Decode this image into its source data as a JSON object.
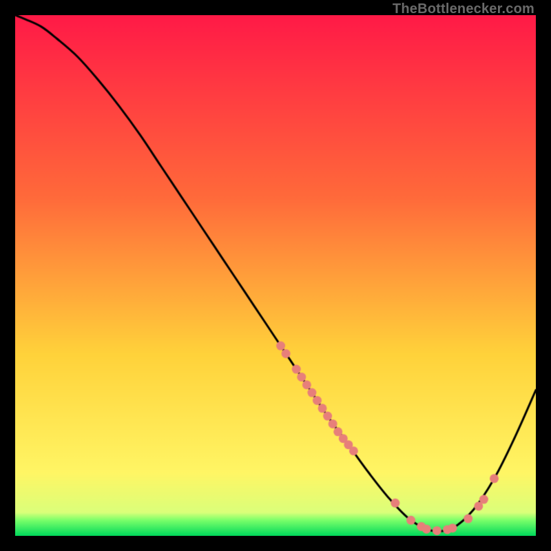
{
  "attribution": "TheBottlenecker.com",
  "colors": {
    "gradient_top": "#ff1a47",
    "gradient_mid1": "#ff6a3a",
    "gradient_mid2": "#ffd23a",
    "gradient_mid3": "#fff665",
    "gradient_bottom": "#00d95b",
    "curve": "#000000",
    "marker": "#e77f7a",
    "frame_bg": "#000000"
  },
  "chart_data": {
    "type": "line",
    "title": "",
    "xlabel": "",
    "ylabel": "",
    "xlim": [
      0,
      100
    ],
    "ylim": [
      0,
      100
    ],
    "grid": false,
    "legend": false,
    "series": [
      {
        "name": "bottleneck-curve",
        "x": [
          0,
          2,
          5,
          8,
          12,
          16,
          20,
          24,
          28,
          32,
          36,
          40,
          44,
          48,
          52,
          56,
          60,
          64,
          68,
          72,
          76,
          80,
          84,
          88,
          92,
          96,
          100
        ],
        "y": [
          100,
          99.2,
          97.8,
          95.5,
          92.0,
          87.5,
          82.5,
          77.0,
          71.0,
          65.0,
          59.0,
          53.0,
          47.0,
          41.0,
          35.0,
          29.0,
          23.0,
          17.5,
          12.0,
          7.0,
          3.0,
          1.0,
          1.5,
          5.0,
          11.0,
          19.0,
          28.0
        ]
      }
    ],
    "markers": {
      "name": "highlighted-points",
      "x": [
        51,
        52,
        54,
        55,
        56,
        57,
        58,
        59,
        60,
        61,
        62,
        63,
        64,
        65,
        73,
        76,
        78,
        79,
        81,
        83,
        84,
        87,
        89,
        90,
        92
      ],
      "y": [
        36.5,
        35.0,
        32.0,
        30.5,
        29.0,
        27.5,
        26.0,
        24.5,
        23.0,
        21.5,
        20.0,
        18.7,
        17.5,
        16.3,
        6.3,
        3.0,
        1.8,
        1.3,
        1.0,
        1.2,
        1.5,
        3.3,
        5.7,
        7.0,
        11.0
      ]
    }
  }
}
